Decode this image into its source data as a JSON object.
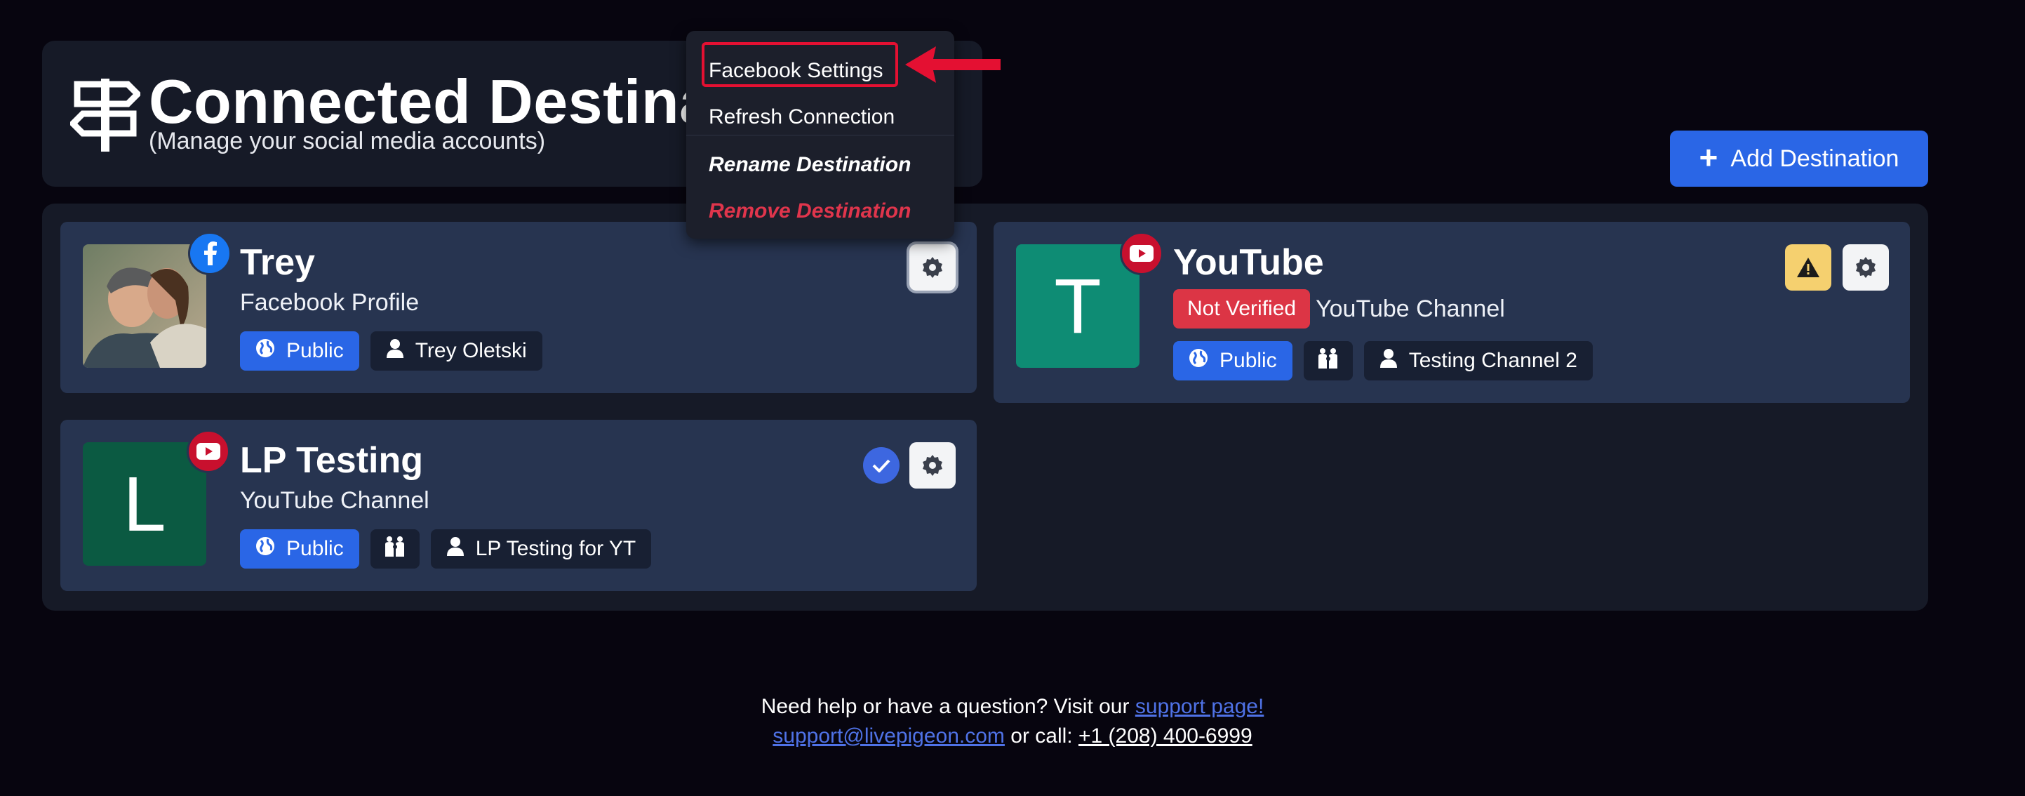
{
  "header": {
    "title": "Connected Destina",
    "subtitle": "(Manage your social media accounts)"
  },
  "add_button": {
    "label": "Add Destination"
  },
  "menu": {
    "items": [
      {
        "label": "Facebook Settings"
      },
      {
        "label": "Refresh Connection"
      },
      {
        "label": "Rename Destination"
      },
      {
        "label": "Remove Destination"
      }
    ]
  },
  "cards": {
    "trey": {
      "name": "Trey",
      "type": "Facebook Profile",
      "visibility": "Public",
      "account": "Trey Oletski",
      "platform": "facebook-icon"
    },
    "youtube": {
      "initial": "T",
      "name": "YouTube",
      "badge": "Not Verified",
      "type": "YouTube Channel",
      "visibility": "Public",
      "account": "Testing Channel 2",
      "platform": "youtube-icon",
      "avatar_color": "#0e8c74"
    },
    "lp": {
      "initial": "L",
      "name": "LP Testing",
      "type": "YouTube Channel",
      "visibility": "Public",
      "account": "LP Testing for YT",
      "platform": "youtube-icon",
      "avatar_color": "#0b5a42"
    }
  },
  "footer": {
    "line1_text": "Need help or have a question? Visit our",
    "support_link": "support page!",
    "email_link": "support@livepigeon.com",
    "call_text": "or call:",
    "phone_link": "+1 (208) 400-6999"
  },
  "colors": {
    "accent": "#2a66e6",
    "danger": "#dc3545",
    "warning": "#f5d06f",
    "highlight": "#e41032"
  }
}
